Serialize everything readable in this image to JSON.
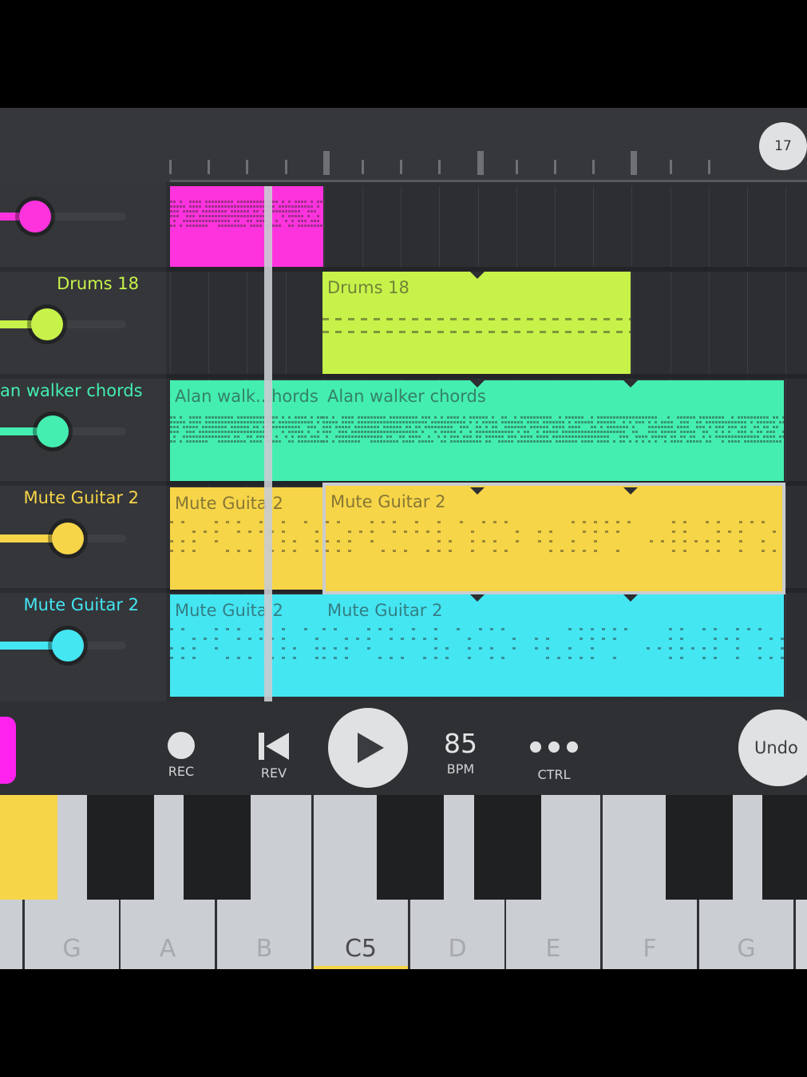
{
  "header": {
    "bar_number": "17"
  },
  "tracks": [
    {
      "name": "",
      "color": "#ff33dd",
      "volume": 0.28
    },
    {
      "name": "Drums 18",
      "color": "#c7f24a",
      "volume": 0.37
    },
    {
      "name": "an walker chords",
      "color": "#44eeb0",
      "volume": 0.42
    },
    {
      "name": "Mute Guitar 2",
      "color": "#f7d548",
      "volume": 0.54
    },
    {
      "name": "Mute Guitar 2",
      "color": "#44e6f2",
      "volume": 0.54
    }
  ],
  "clips": {
    "pink_label": "",
    "drums": "Drums 18",
    "chords_a": "Alan walk...hords",
    "chords_b": "Alan walker chords",
    "guitar_a1": "Mute Guita 2",
    "guitar_a2": "Mute Guitar 2",
    "guitar_b1": "Mute Guita 2",
    "guitar_b2": "Mute Guitar 2"
  },
  "transport": {
    "rec_label": "REC",
    "rev_label": "REV",
    "bpm_value": "85",
    "bpm_label": "BPM",
    "ctrl_label": "CTRL",
    "undo_label": "Undo"
  },
  "keyboard": {
    "keys": [
      "",
      "G",
      "A",
      "B",
      "C5",
      "D",
      "E",
      "F",
      "G"
    ],
    "active_key": "C5",
    "highlight_color": "#f7d548"
  }
}
